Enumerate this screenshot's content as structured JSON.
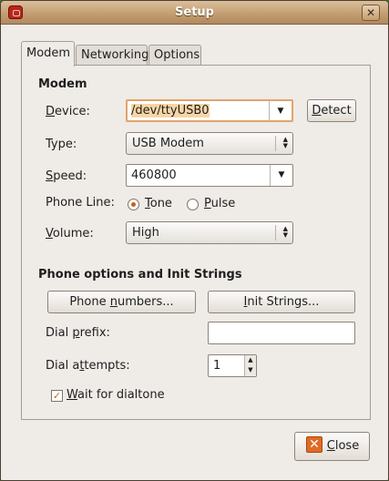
{
  "window": {
    "title": "Setup",
    "close_glyph": "✕"
  },
  "tabs": [
    {
      "label": "Modem"
    },
    {
      "label": "Networking"
    },
    {
      "label": "Options"
    }
  ],
  "modem": {
    "heading": "Modem",
    "device_label_pre": "",
    "device_label_u": "D",
    "device_label_post": "evice:",
    "device_value": "/dev/ttyUSB0",
    "detect_u": "D",
    "detect_post": "etect",
    "type_label": "Type:",
    "type_value": "USB Modem",
    "speed_label_u": "S",
    "speed_label_post": "peed:",
    "speed_value": "460800",
    "phone_line_label": "Phone Line:",
    "tone_u": "T",
    "tone_post": "one",
    "tone_selected": true,
    "pulse_u": "P",
    "pulse_post": "ulse",
    "volume_label_u": "V",
    "volume_label_post": "olume:",
    "volume_value": "High"
  },
  "phone_options": {
    "heading": "Phone options and Init Strings",
    "phone_numbers_pre": "Phone ",
    "phone_numbers_u": "n",
    "phone_numbers_post": "umbers...",
    "init_u": "I",
    "init_post": "nit Strings...",
    "dial_prefix_pre": "Dial ",
    "dial_prefix_u": "p",
    "dial_prefix_post": "refix:",
    "dial_prefix_value": "",
    "dial_attempts_pre": "Dial a",
    "dial_attempts_u": "t",
    "dial_attempts_post": "tempts:",
    "dial_attempts_value": "1",
    "wait_u": "W",
    "wait_post": "ait for dialtone",
    "wait_checked": true
  },
  "footer": {
    "close_u": "C",
    "close_post": "lose"
  },
  "colors": {
    "accent": "#c9611f",
    "titlebar": "#c49e72",
    "selection": "#f7d6a6"
  }
}
